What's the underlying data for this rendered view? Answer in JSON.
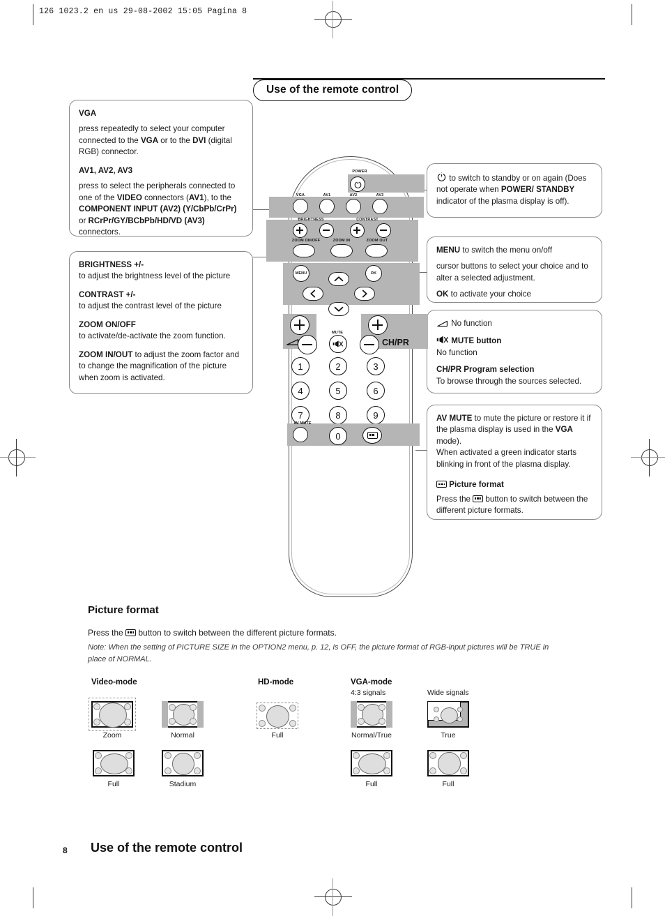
{
  "slug": "126 1023.2 en us  29-08-2002  15:05  Pagina 8",
  "title": "Use of the remote control",
  "callouts": {
    "vga": {
      "h1": "VGA",
      "p1_a": "press repeatedly to select your computer connected to the ",
      "p1_b": "VGA",
      "p1_c": " or to the ",
      "p1_d": "DVI",
      "p1_e": " (digital RGB) connector.",
      "h2": "AV1, AV2, AV3",
      "p2_a": "press to select the peripherals connected to one of the ",
      "p2_b": "VIDEO",
      "p2_c": " connectors (",
      "p2_d": "AV1",
      "p2_e": "), to the ",
      "p2_f": "COMPONENT INPUT (AV2) (Y/CbPb/CrPr)",
      "p2_g": " or ",
      "p2_h": "RCrPr/GY/BCbPb/HD/VD (AV3)",
      "p2_i": "  connectors."
    },
    "brightness": {
      "h1": "BRIGHTNESS +/-",
      "p1": "to adjust the brightness level of the picture",
      "h2": "CONTRAST +/-",
      "p2": "to adjust the contrast level of the picture",
      "h3": "ZOOM ON/OFF",
      "p3": "to activate/de-activate the zoom function.",
      "h4": "ZOOM IN/OUT",
      "p4": " to adjust the zoom factor and to change the magnification of the picture when zoom is activated."
    },
    "standby": {
      "icon": "power-icon",
      "p_a": "  to switch to standby or on again (Does not operate when ",
      "p_b": "POWER/ STANDBY",
      "p_c": " indicator of the plasma display is off)."
    },
    "menu": {
      "h1": "MENU",
      "p1": "   to switch the menu on/off",
      "p2": "cursor buttons to select your choice and to alter a selected adjustment.",
      "h2": "OK",
      "p3": "  to activate your choice"
    },
    "mute": {
      "icon1": "volume-icon",
      "l1": " No function",
      "icon2": "mute-icon",
      "h2": "MUTE button",
      "l2": "No function",
      "h3": "CH/PR",
      "h3b": "  Program selection",
      "l3": "To browse through the sources selected."
    },
    "avmute": {
      "h1": "AV MUTE",
      "p1_a": "  to mute the picture or restore it if the plasma display is used in the ",
      "p1_b": "VGA",
      "p1_c": " mode).",
      "p2": "When activated a green indicator starts blinking in front of the plasma display.",
      "icon": "picture-format-icon",
      "h2": "  Picture format",
      "p3_a": "Press the ",
      "p3_b": " button to switch between the different picture formats."
    }
  },
  "remote": {
    "labels": {
      "power": "POWER",
      "vga": "VGA",
      "av1": "AV1",
      "av2": "AV2",
      "av3": "AV3",
      "brightness": "BRIGHTNESS",
      "contrast": "CONTRAST",
      "zoom_onoff": "ZOOM ON/OFF",
      "zoom_in": "ZOOM IN",
      "zoom_out": "ZOOM OUT",
      "menu": "MENU",
      "ok": "OK",
      "mute": "MUTE",
      "chpr": "CH/PR",
      "av_mute": "AV MUTE"
    },
    "keypad": [
      "1",
      "2",
      "3",
      "4",
      "5",
      "6",
      "7",
      "8",
      "9",
      "0"
    ]
  },
  "picture_format": {
    "heading": "Picture format",
    "line_a": "Press the ",
    "line_b": " button to switch between the different picture formats.",
    "note": "Note: When the setting of PICTURE SIZE in the OPTION2 menu, p. 12, is OFF, the picture format of RGB-input pictures will be TRUE in place of NORMAL.",
    "columns": [
      {
        "head": "Video-mode",
        "sub": "",
        "items": [
          {
            "caption": "Zoom",
            "style": "zoom"
          },
          {
            "caption": "Normal",
            "style": "pillarbox"
          },
          {
            "caption": "Full",
            "style": "full-wide"
          },
          {
            "caption": "Stadium",
            "style": "stadium"
          }
        ]
      },
      {
        "head": "HD-mode",
        "sub": "",
        "items": [
          {
            "caption": "Full",
            "style": "full-dotted"
          }
        ]
      },
      {
        "head": "VGA-mode",
        "sub": "4:3 signals",
        "items": [
          {
            "caption": "Normal/True",
            "style": "pillarbox"
          },
          {
            "caption": "Full",
            "style": "full-wide"
          }
        ]
      },
      {
        "head": "",
        "sub": "Wide signals",
        "items": [
          {
            "caption": "True",
            "style": "boxed-small"
          },
          {
            "caption": "Full",
            "style": "full-tall"
          }
        ]
      }
    ]
  },
  "footer": {
    "page_number": "8",
    "title": "Use of the remote control"
  }
}
